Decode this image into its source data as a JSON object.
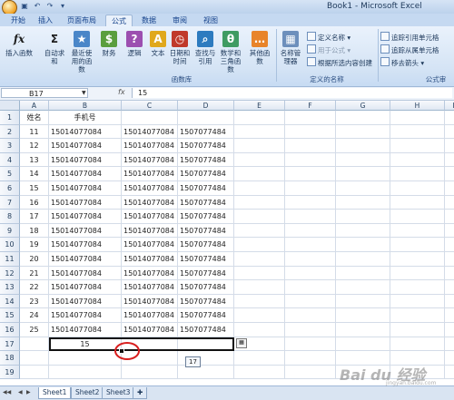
{
  "window": {
    "title": "Book1 - Microsoft Excel"
  },
  "tabs": [
    "开始",
    "插入",
    "页面布局",
    "公式",
    "数据",
    "审阅",
    "视图"
  ],
  "active_tab": "公式",
  "ribbon": {
    "buttons": [
      {
        "label": "插入函数",
        "icon": "fx-icon",
        "glyph": "fx",
        "color": "#ffffff"
      },
      {
        "label": "自动求和",
        "icon": "sigma-icon",
        "glyph": "Σ",
        "color": "#ffffff"
      },
      {
        "label": "最近使用的函数",
        "icon": "recent-functions-icon",
        "glyph": "★",
        "color": "#4a86c8"
      },
      {
        "label": "财务",
        "icon": "financial-icon",
        "glyph": "$",
        "color": "#5a9e3e"
      },
      {
        "label": "逻辑",
        "icon": "logical-icon",
        "glyph": "?",
        "color": "#9c4fb0"
      },
      {
        "label": "文本",
        "icon": "text-icon",
        "glyph": "A",
        "color": "#e0a81c"
      },
      {
        "label": "日期和时间",
        "icon": "datetime-icon",
        "glyph": "◷",
        "color": "#c0392b"
      },
      {
        "label": "查找与引用",
        "icon": "lookup-icon",
        "glyph": "⌕",
        "color": "#2d7bbf"
      },
      {
        "label": "数学和三角函数",
        "icon": "math-icon",
        "glyph": "θ",
        "color": "#3f9b62"
      },
      {
        "label": "其他函数",
        "icon": "more-functions-icon",
        "glyph": "…",
        "color": "#e8842a"
      },
      {
        "label": "名称管理器",
        "icon": "name-manager-icon",
        "glyph": "▦",
        "color": "#6d8fbc"
      }
    ],
    "group_function_library": "函数库",
    "group_defined_names": "定义的名称",
    "group_formula_audit": "公式审",
    "defined_names": {
      "define_name": "定义名称 ▾",
      "use_in_formula": "用于公式 ▾",
      "create_from_selection": "根据所选内容创建"
    },
    "audit": {
      "trace_precedents": "追踪引用单元格",
      "trace_dependents": "追踪从属单元格",
      "remove_arrows": "移去箭头 ▾"
    }
  },
  "formula_bar": {
    "name_box": "B17",
    "fx": "fx",
    "value": "15"
  },
  "columns": [
    "A",
    "B",
    "C",
    "D",
    "E",
    "F",
    "G",
    "H",
    "I"
  ],
  "rows": [
    [
      "姓名",
      "手机号",
      "",
      ""
    ],
    [
      "11",
      "15014077084",
      "15014077084",
      "1507077484"
    ],
    [
      "12",
      "15014077084",
      "15014077084",
      "1507077484"
    ],
    [
      "13",
      "15014077084",
      "15014077084",
      "1507077484"
    ],
    [
      "14",
      "15014077084",
      "15014077084",
      "1507077484"
    ],
    [
      "15",
      "15014077084",
      "15014077084",
      "1507077484"
    ],
    [
      "16",
      "15014077084",
      "15014077084",
      "1507077484"
    ],
    [
      "17",
      "15014077084",
      "15014077084",
      "1507077484"
    ],
    [
      "18",
      "15014077084",
      "15014077084",
      "1507077484"
    ],
    [
      "19",
      "15014077084",
      "15014077084",
      "1507077484"
    ],
    [
      "20",
      "15014077084",
      "15014077084",
      "1507077484"
    ],
    [
      "21",
      "15014077084",
      "15014077084",
      "1507077484"
    ],
    [
      "22",
      "15014077084",
      "15014077084",
      "1507077484"
    ],
    [
      "23",
      "15014077084",
      "15014077084",
      "1507077484"
    ],
    [
      "24",
      "15014077084",
      "15014077084",
      "1507077484"
    ],
    [
      "25",
      "15014077084",
      "15014077084",
      "1507077484"
    ],
    [
      "",
      "15",
      "",
      ""
    ],
    [
      "",
      "",
      "",
      ""
    ],
    [
      "",
      "",
      "",
      ""
    ]
  ],
  "row_numbers": [
    "1",
    "2",
    "3",
    "4",
    "5",
    "6",
    "7",
    "8",
    "9",
    "10",
    "11",
    "12",
    "13",
    "14",
    "15",
    "16",
    "17",
    "18",
    "19"
  ],
  "tooltip": "17",
  "sheets": [
    "Sheet1",
    "Sheet2",
    "Sheet3"
  ],
  "active_sheet": "Sheet1",
  "watermark": {
    "text": "Bai du 经验",
    "sub": "jingyan.baidu.com"
  },
  "colors": {
    "ribbon": "#d5e4f5",
    "accent": "#15428b",
    "highlight_circle": "#d81e1e"
  }
}
